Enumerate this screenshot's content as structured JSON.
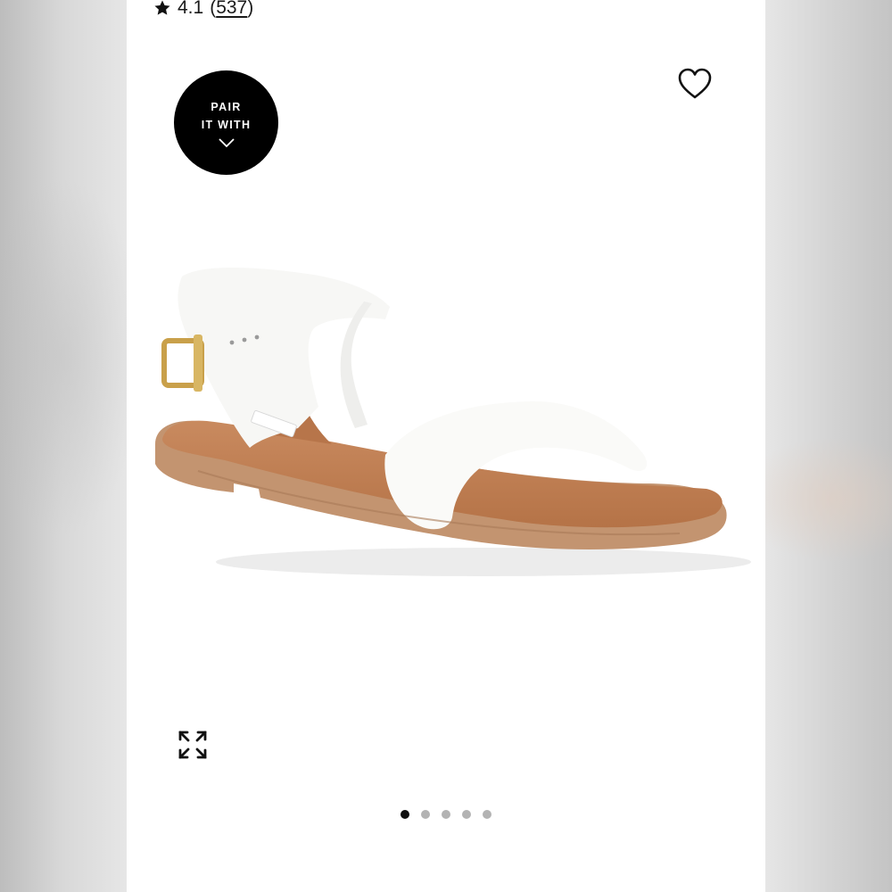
{
  "product": {
    "rating": "4.1",
    "review_count_open": "(",
    "review_count": "537",
    "review_count_close": ")",
    "image_icon": "white-ankle-strap-sandal"
  },
  "pair_badge": {
    "line1": "PAIR",
    "line2": "IT WITH",
    "icon": "chevron-down-icon"
  },
  "icons": {
    "rating": "star-icon",
    "favorite": "heart-icon",
    "expand": "expand-arrows-icon"
  },
  "gallery": {
    "total_images": 5,
    "active_index": 0
  },
  "colors": {
    "badge_bg": "#000000",
    "active_dot": "#111111",
    "inactive_dot": "#b3b3b3"
  }
}
